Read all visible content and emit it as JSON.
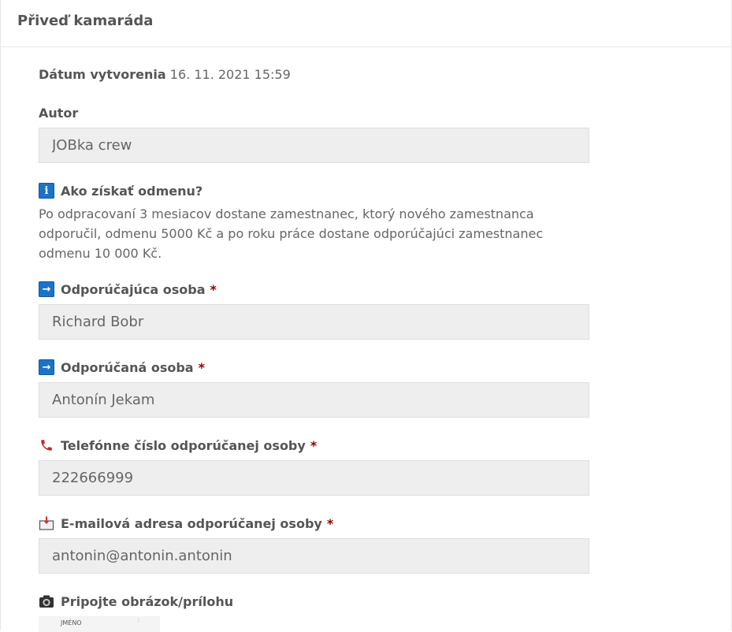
{
  "header": {
    "title": "Přiveď kamaráda"
  },
  "meta": {
    "created_label": "Dátum vytvorenia",
    "created_value": "16. 11. 2021 15:59"
  },
  "author": {
    "label": "Autor",
    "value": "JOBka crew"
  },
  "reward": {
    "label": "Ako získať odmenu?",
    "icon": "info-icon",
    "text": "Po odpracovaní 3 mesiacov dostane zamestnanec, ktorý nového zamestnanca odporučil, odmenu 5000 Kč a po roku práce dostane odporúčajúci zamestnanec odmenu 10 000 Kč."
  },
  "referrer": {
    "label": "Odporúčajúca osoba",
    "required": "*",
    "icon": "arrow-right-icon",
    "value": "Richard Bobr"
  },
  "referred": {
    "label": "Odporúčaná osoba",
    "required": "*",
    "icon": "arrow-right-icon",
    "value": "Antonín Jekam"
  },
  "phone": {
    "label": "Telefónne číslo odporúčanej osoby",
    "required": "*",
    "icon": "telephone-icon",
    "value": "222666999"
  },
  "email": {
    "label": "E-mailová adresa odporúčanej osoby",
    "required": "*",
    "icon": "inbox-icon",
    "value": "antonin@antonin.antonin"
  },
  "attachment": {
    "label": "Pripojte obrázok/prílohu",
    "icon": "camera-icon",
    "thumb_text": "JMÉNO"
  },
  "colors": {
    "required": "#8b0000",
    "icon_blue": "#1a73c8",
    "field_bg": "#eeeeee"
  }
}
